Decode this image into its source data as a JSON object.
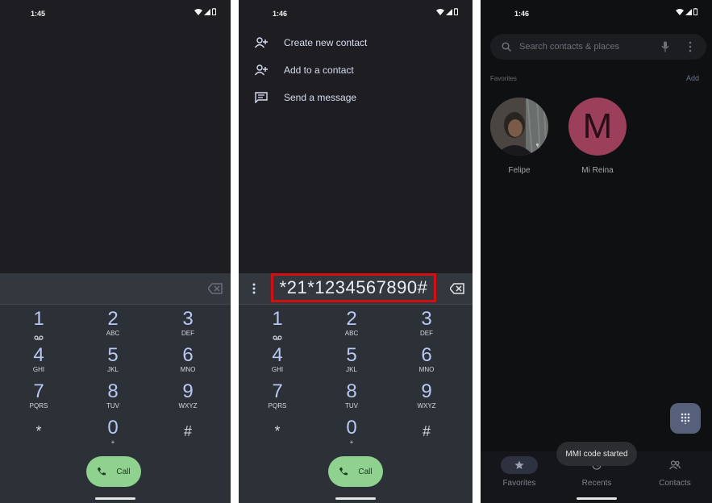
{
  "panel1": {
    "status_time": "1:45",
    "keys": [
      {
        "num": "1",
        "sub": "voicemail-icon"
      },
      {
        "num": "2",
        "sub": "ABC"
      },
      {
        "num": "3",
        "sub": "DEF"
      },
      {
        "num": "4",
        "sub": "GHI"
      },
      {
        "num": "5",
        "sub": "JKL"
      },
      {
        "num": "6",
        "sub": "MNO"
      },
      {
        "num": "7",
        "sub": "PQRS"
      },
      {
        "num": "8",
        "sub": "TUV"
      },
      {
        "num": "9",
        "sub": "WXYZ"
      },
      {
        "num": "*",
        "sub": ""
      },
      {
        "num": "0",
        "sub": "+"
      },
      {
        "num": "#",
        "sub": ""
      }
    ],
    "call_label": "Call"
  },
  "panel2": {
    "status_time": "1:46",
    "menu": [
      {
        "label": "Create new contact",
        "icon": "person-add-icon"
      },
      {
        "label": "Add to a contact",
        "icon": "person-add-icon"
      },
      {
        "label": "Send a message",
        "icon": "message-icon"
      }
    ],
    "dialed_number": "*21*1234567890#",
    "keys": [
      {
        "num": "1",
        "sub": "voicemail-icon"
      },
      {
        "num": "2",
        "sub": "ABC"
      },
      {
        "num": "3",
        "sub": "DEF"
      },
      {
        "num": "4",
        "sub": "GHI"
      },
      {
        "num": "5",
        "sub": "JKL"
      },
      {
        "num": "6",
        "sub": "MNO"
      },
      {
        "num": "7",
        "sub": "PQRS"
      },
      {
        "num": "8",
        "sub": "TUV"
      },
      {
        "num": "9",
        "sub": "WXYZ"
      },
      {
        "num": "*",
        "sub": ""
      },
      {
        "num": "0",
        "sub": "+"
      },
      {
        "num": "#",
        "sub": ""
      }
    ],
    "call_label": "Call"
  },
  "panel3": {
    "status_time": "1:46",
    "search_placeholder": "Search contacts & places",
    "favorites_label": "Favorites",
    "add_label": "Add",
    "favorites": [
      {
        "name": "Felipe",
        "avatar": "photo"
      },
      {
        "name": "Mi Reina",
        "avatar": "M"
      }
    ],
    "toast": "MMI code started",
    "nav": [
      {
        "label": "Favorites",
        "icon": "star-icon"
      },
      {
        "label": "Recents",
        "icon": "clock-icon"
      },
      {
        "label": "Contacts",
        "icon": "people-icon"
      }
    ]
  },
  "colors": {
    "dialer_bg": "#1e1d21",
    "dialpad_bg": "#2c3037",
    "digit": "#b9c7f4",
    "call_green": "#8fd18e",
    "highlight_red": "#d40f10",
    "avatar_pink": "#9c3f5b"
  }
}
